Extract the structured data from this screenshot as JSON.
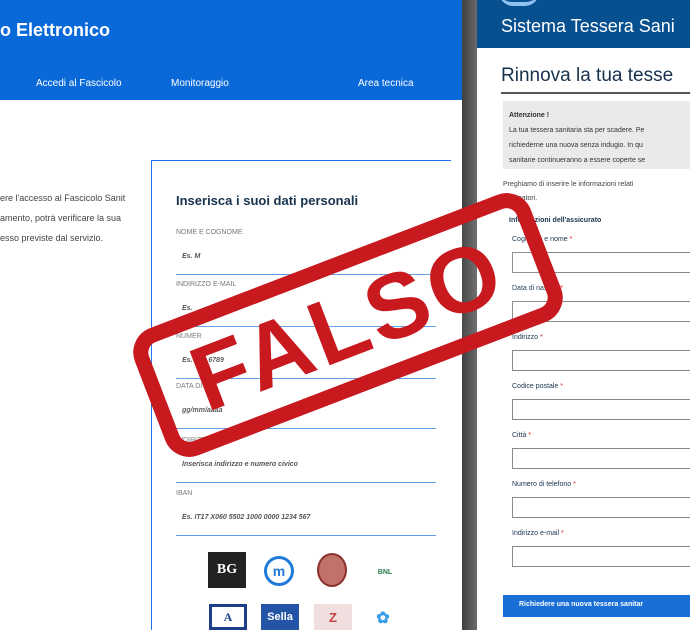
{
  "left_window": {
    "app_title": "o Elettronico",
    "nav": [
      "Accedi al Fascicolo",
      "Monitoraggio",
      "Area tecnica"
    ],
    "intro_lines": [
      "ere l'accesso al Fascicolo Sanit",
      "amento, potrà verificare la sua",
      "esso previste dal servizio."
    ],
    "form_title": "Inserisca i suoi dati personali",
    "fields": [
      {
        "label": "NOME E COGNOME",
        "placeholder": "Es. M"
      },
      {
        "label": "INDIRIZZO E-MAIL",
        "placeholder": "Es."
      },
      {
        "label": "NUMER",
        "placeholder": "Es. +39 6789"
      },
      {
        "label": "DATA DI NA",
        "placeholder": "gg/mm/aaaa"
      },
      {
        "label": "INDIRIZZO",
        "placeholder": "Inserisca indirizzo e numero civico"
      },
      {
        "label": "IBAN",
        "placeholder": "Es. IT17 X060 5502 1000 0000 1234 567"
      }
    ],
    "bank_logos": {
      "bg": "BG",
      "m": "m",
      "bnl": "BNL",
      "a": "A",
      "sella": "Sella",
      "z": "Z",
      "flower": "✿"
    }
  },
  "right_window": {
    "app_title": "Sistema Tessera Sani",
    "page_title": "Rinnova la tua tesse",
    "alert": {
      "title": "Attenzione !",
      "lines": [
        "La tua tessera sanitaria sta per scadere. Pe",
        "richiederne una nuova senza indugio. In qu",
        "sanitarie continueranno a essere coperte se"
      ]
    },
    "note_lines": [
      "Preghiamo di inserire le informazioni relati",
      "obbligatori."
    ],
    "section_title": "Informazioni dell'assicurato",
    "fields": [
      {
        "label": "Cognome e nome",
        "required": "*"
      },
      {
        "label": "Data di nascita",
        "required": "*"
      },
      {
        "label": "Indirizzo",
        "required": "*"
      },
      {
        "label": "Codice postale",
        "required": "*"
      },
      {
        "label": "Città",
        "required": "*"
      },
      {
        "label": "Numero di telefono",
        "required": "*"
      },
      {
        "label": "Indirizzo e-mail",
        "required": "*"
      }
    ],
    "submit_label": "Richiedere una nuova tessera sanitar"
  },
  "stamp": {
    "text": "FALSO"
  },
  "colors": {
    "left_header": "#0a69d9",
    "right_header": "#07508f",
    "stamp": "#c8191f",
    "submit": "#1a6fd6"
  }
}
